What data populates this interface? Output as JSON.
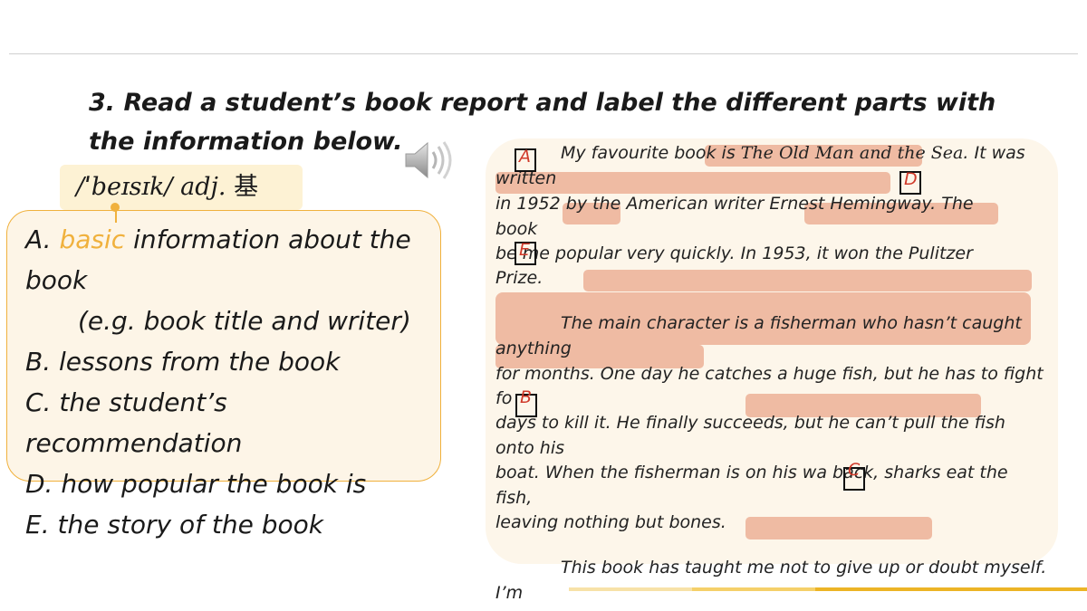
{
  "title": "3. Read a student’s book report and label the different parts with the information below.",
  "phonetic": {
    "ipa": "/ˈbeɪsɪk/",
    "pos": "adj.",
    "gloss": "基"
  },
  "options": {
    "a_prefix": "A. ",
    "a_highlight": "basic",
    "a_rest": " information about the",
    "a_line2": "book",
    "a_line3": "(e.g. book title and writer)",
    "b": "B. lessons from the book",
    "c_line1": "C. the student’s",
    "c_line2": "recommendation",
    "d": "D. how popular the book is",
    "e": "E. the story of the book"
  },
  "report": {
    "l1a": "My favourite book is ",
    "l1b": "The Old Man and the Sea",
    "l1c": ". It was",
    "l2": "written",
    "l3": "in 1952 by the American writer Ernest Hemingway.     The",
    "l4": "book",
    "l5": "be    me popular very quickly. In 1953, it won the Pulitzer",
    "l6": "Prize.",
    "l7": "The main character is a fisherman who hasn’t caught",
    "l8": "anything",
    "l9": "for months. One day he catches a huge fish, but he has to fight",
    "l10": "fo",
    "l11": "days to kill it. He finally succeeds, but he can’t pull the fish",
    "l12": "onto his",
    "l13": "boat. When the fisherman is on his wa     back, sharks eat the",
    "l14": "fish,",
    "l15": "leaving nothing but bones.",
    "l16": "This book has taught me not to give up or doubt myself.",
    "l17": "I’m"
  },
  "labels": {
    "a": "A",
    "b": "B",
    "c": "C",
    "d": "D",
    "e": "E"
  },
  "colors": {
    "highlight_band": "#efbba3",
    "accent": "#f0b13d",
    "label_letter": "#d03a2a"
  },
  "icons": {
    "speaker": "speaker-icon"
  }
}
